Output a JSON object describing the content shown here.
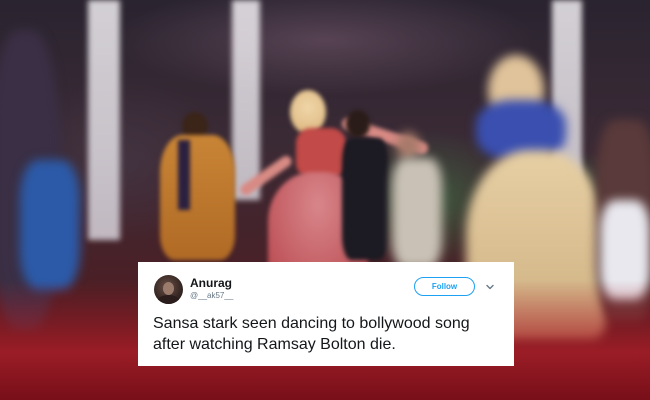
{
  "tweet": {
    "display_name": "Anurag",
    "handle": "@__ak57__",
    "follow_label": "Follow",
    "text": "Sansa stark seen dancing to bollywood song after watching Ramsay Bolton die."
  },
  "colors": {
    "accent": "#1da1f2",
    "text_primary": "#14171a",
    "text_secondary": "#657786"
  },
  "icons": {
    "more": "chevron-down-icon",
    "avatar": "avatar"
  }
}
